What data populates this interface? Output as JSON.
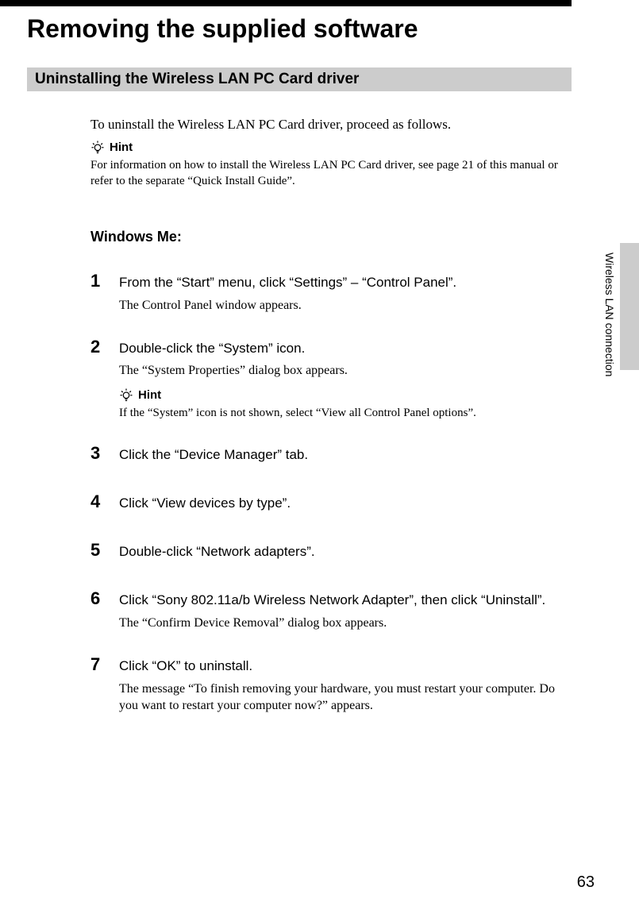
{
  "page": {
    "title": "Removing the supplied software",
    "section": "Uninstalling the Wireless LAN PC Card driver",
    "intro": "To uninstall the Wireless LAN PC Card driver, proceed as follows.",
    "hint_label": "Hint",
    "hint_body": "For information on how to install the Wireless LAN PC Card driver, see page 21 of this manual or refer to the separate “Quick Install Guide”.",
    "os_heading": "Windows Me:",
    "steps": [
      {
        "num": "1",
        "title": "From the “Start” menu, click “Settings” – “Control Panel”.",
        "desc": "The Control Panel window appears."
      },
      {
        "num": "2",
        "title": "Double-click the “System” icon.",
        "desc": "The “System Properties” dialog box appears.",
        "hint_label": "Hint",
        "hint_body": "If the “System” icon is not shown, select “View all Control Panel options”."
      },
      {
        "num": "3",
        "title": "Click the “Device Manager” tab."
      },
      {
        "num": "4",
        "title": "Click “View devices by type”."
      },
      {
        "num": "5",
        "title": "Double-click “Network adapters”."
      },
      {
        "num": "6",
        "title": "Click “Sony 802.11a/b Wireless Network Adapter”, then click “Uninstall”.",
        "desc": "The “Confirm Device Removal” dialog box appears."
      },
      {
        "num": "7",
        "title": "Click “OK” to uninstall.",
        "desc": "The message “To finish removing your hardware, you must restart your computer. Do you want to restart your computer now?” appears."
      }
    ],
    "side_label": "Wireless LAN connection",
    "page_number": "63"
  }
}
